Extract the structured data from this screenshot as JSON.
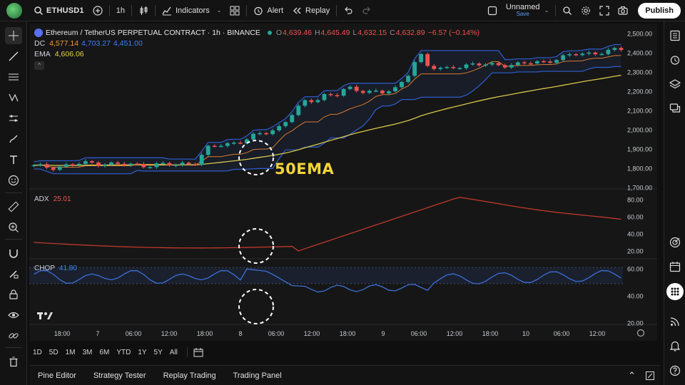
{
  "topbar": {
    "symbol": "ETHUSD1",
    "interval": "1h",
    "indicators_label": "Indicators",
    "alert_label": "Alert",
    "replay_label": "Replay",
    "layout_name": "Unnamed",
    "layout_status": "Save",
    "publish_label": "Publish"
  },
  "legend": {
    "title": "Ethereum / TetherUS PERPETUAL CONTRACT · 1h · BINANCE",
    "o_label": "O",
    "o_value": "4,639.46",
    "h_label": "H",
    "h_value": "4,645.49",
    "l_label": "L",
    "l_value": "4,632.15",
    "c_label": "C",
    "c_value": "4,632.89",
    "change": "−6.57 (−0.14%)",
    "dc_label": "DC",
    "dc_v1": "4,577.14",
    "dc_v2": "4,703.27",
    "dc_v3": "4,451.00",
    "ema_label": "EMA",
    "ema_value": "4,606.06",
    "collapse": "^"
  },
  "annotation": "50EMA",
  "adx": {
    "label": "ADX",
    "value": "25.01"
  },
  "chop": {
    "label": "CHOP",
    "value": "41.80"
  },
  "price_axis": [
    "2,500.00",
    "2,400.00",
    "2,300.00",
    "2,200.00",
    "2,100.00",
    "2,000.00",
    "1,900.00",
    "1,800.00",
    "1,700.00"
  ],
  "adx_axis": [
    "80.00",
    "60.00",
    "40.00",
    "20.00"
  ],
  "chop_axis": [
    "60.00",
    "40.00",
    "20.00"
  ],
  "time_axis": [
    "18:00",
    "7",
    "06:00",
    "12:00",
    "18:00",
    "8",
    "06:00",
    "12:00",
    "18:00",
    "9",
    "06:00",
    "12:00",
    "18:00",
    "10",
    "06:00",
    "12:00"
  ],
  "ranges": [
    "1D",
    "5D",
    "1M",
    "3M",
    "6M",
    "YTD",
    "1Y",
    "5Y",
    "All"
  ],
  "panel_tabs": [
    "Pine Editor",
    "Strategy Tester",
    "Replay Trading",
    "Trading Panel"
  ],
  "colors": {
    "up": "#26a69a",
    "down": "#ef5350",
    "dc_band": "#2f5fd0",
    "dc_mid": "#d9792b",
    "ema": "#d8c54a",
    "adx": "#c0392b",
    "chop": "#3c6fd8"
  }
}
